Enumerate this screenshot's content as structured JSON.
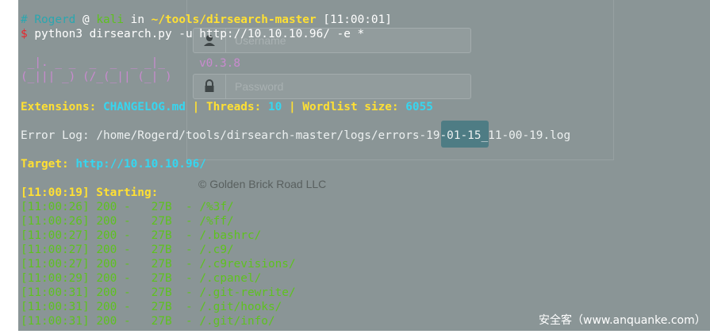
{
  "prompt": {
    "hash": "#",
    "user": "Rogerd",
    "at": "@",
    "host": "kali",
    "in": "in",
    "path": "~/tools/dirsearch-master",
    "time": "[11:00:01]",
    "marker": "$",
    "command": "python3 dirsearch.py -u http://10.10.10.96/ -e *"
  },
  "banner": {
    "line1": " _|. _ _  _  _  _ _|_   ",
    "line2": "(_||| _) (/_(_|| (_| )",
    "version": "v0.3.8"
  },
  "summary": {
    "ext_label": "Extensions:",
    "ext_value": "CHANGELOG.md",
    "sep1": "|",
    "threads_label": "Threads:",
    "threads_value": "10",
    "sep2": "|",
    "wordlist_label": "Wordlist size:",
    "wordlist_value": "6055"
  },
  "error_log": {
    "label": "Error Log:",
    "path": "/home/Rogerd/tools/dirsearch-master/logs/errors-19-01-15_11-00-19.log"
  },
  "target": {
    "label": "Target:",
    "url": "http://10.10.10.96/"
  },
  "starting": "[11:00:19] Starting:",
  "results": [
    {
      "time": "[11:00:26]",
      "status": "200",
      "dash": "-",
      "size": "27B",
      "arrow": "-",
      "path": "/%3f/"
    },
    {
      "time": "[11:00:26]",
      "status": "200",
      "dash": "-",
      "size": "27B",
      "arrow": "-",
      "path": "/%ff/"
    },
    {
      "time": "[11:00:27]",
      "status": "200",
      "dash": "-",
      "size": "27B",
      "arrow": "-",
      "path": "/.bashrc/"
    },
    {
      "time": "[11:00:27]",
      "status": "200",
      "dash": "-",
      "size": "27B",
      "arrow": "-",
      "path": "/.c9/"
    },
    {
      "time": "[11:00:27]",
      "status": "200",
      "dash": "-",
      "size": "27B",
      "arrow": "-",
      "path": "/.c9revisions/"
    },
    {
      "time": "[11:00:29]",
      "status": "200",
      "dash": "-",
      "size": "27B",
      "arrow": "-",
      "path": "/.cpanel/"
    },
    {
      "time": "[11:00:31]",
      "status": "200",
      "dash": "-",
      "size": "27B",
      "arrow": "-",
      "path": "/.git-rewrite/"
    },
    {
      "time": "[11:00:31]",
      "status": "200",
      "dash": "-",
      "size": "27B",
      "arrow": "-",
      "path": "/.git/hooks/"
    },
    {
      "time": "[11:00:31]",
      "status": "200",
      "dash": "-",
      "size": "27B",
      "arrow": "-",
      "path": "/.git/info/"
    }
  ],
  "background_page": {
    "username_placeholder": "Username",
    "password_placeholder": "Password",
    "copyright": "© Golden Brick Road LLC"
  },
  "watermark": "安全客（www.anquanke.com）",
  "icons": [
    "user-icon",
    "lock-icon"
  ],
  "colors": {
    "terminal_bg": "#8a9596",
    "yellow": "#ffe033",
    "cyan": "#36d6f0",
    "green": "#5ec21f",
    "red": "#e8262d"
  }
}
